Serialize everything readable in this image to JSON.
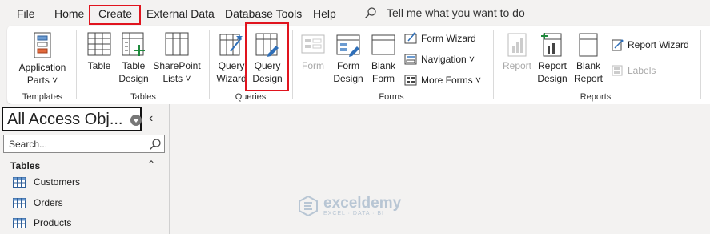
{
  "menu": {
    "items": [
      "File",
      "Home",
      "Create",
      "External Data",
      "Database Tools",
      "Help"
    ],
    "tell_me": "Tell me what you want to do"
  },
  "ribbon": {
    "templates": {
      "label": "Templates",
      "application_parts": [
        "Application",
        "Parts ˅"
      ]
    },
    "tables": {
      "label": "Tables",
      "table": [
        "Table"
      ],
      "table_design": [
        "Table",
        "Design"
      ],
      "sharepoint_lists": [
        "SharePoint",
        "Lists ˅"
      ]
    },
    "queries": {
      "label": "Queries",
      "query_wizard": [
        "Query",
        "Wizard"
      ],
      "query_design": [
        "Query",
        "Design"
      ]
    },
    "forms": {
      "label": "Forms",
      "form": [
        "Form"
      ],
      "form_design": [
        "Form",
        "Design"
      ],
      "blank_form": [
        "Blank",
        "Form"
      ],
      "form_wizard": "Form Wizard",
      "navigation": "Navigation ˅",
      "more_forms": "More Forms ˅"
    },
    "reports": {
      "label": "Reports",
      "report": [
        "Report"
      ],
      "report_design": [
        "Report",
        "Design"
      ],
      "blank_report": [
        "Blank",
        "Report"
      ],
      "report_wizard": "Report Wizard",
      "labels": "Labels"
    }
  },
  "nav_pane": {
    "title": "All Access Obj...",
    "search_placeholder": "Search...",
    "category": "Tables",
    "objects": [
      "Customers",
      "Orders",
      "Products"
    ]
  },
  "watermark": {
    "name": "exceldemy",
    "tagline": "EXCEL · DATA · BI"
  },
  "colors": {
    "highlight": "#e0141e",
    "workspace": "#f3f2f1",
    "ribbon": "#ffffff"
  }
}
